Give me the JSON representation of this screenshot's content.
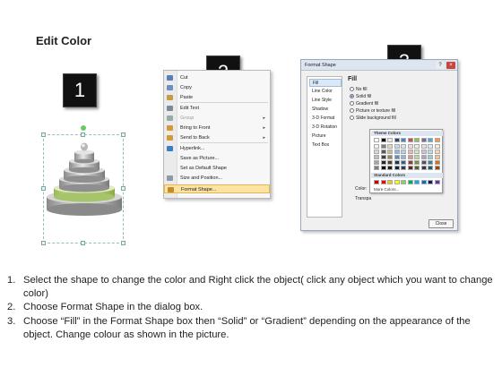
{
  "page": {
    "title": "Edit Color"
  },
  "badges": [
    "1",
    "2",
    "3"
  ],
  "context_menu": {
    "items": [
      {
        "label": "Cut",
        "icon": "scissors-icon",
        "icon_color": "#5a7fb5"
      },
      {
        "label": "Copy",
        "icon": "copy-icon",
        "icon_color": "#6e8fbf"
      },
      {
        "label": "Paste",
        "icon": "paste-icon",
        "icon_color": "#c59b45"
      },
      {
        "label": "Edit Text",
        "icon": "edit-text-icon",
        "icon_color": "#7a8a9a"
      },
      {
        "label": "Group",
        "icon": "group-icon",
        "icon_color": "#9aa",
        "disabled": true,
        "submenu": true
      },
      {
        "label": "Bring to Front",
        "icon": "bring-front-icon",
        "icon_color": "#d49a3a",
        "submenu": true
      },
      {
        "label": "Send to Back",
        "icon": "send-back-icon",
        "icon_color": "#d49a3a",
        "submenu": true
      },
      {
        "label": "Hyperlink...",
        "icon": "hyperlink-icon",
        "icon_color": "#3a7fc5"
      },
      {
        "label": "Save as Picture...",
        "icon": ""
      },
      {
        "label": "Set as Default Shape",
        "icon": ""
      },
      {
        "label": "Size and Position...",
        "icon": "size-position-icon",
        "icon_color": "#8a9aaa"
      },
      {
        "label": "Format Shape...",
        "icon": "format-shape-icon",
        "icon_color": "#c58a2a",
        "highlighted": true
      }
    ]
  },
  "dialog": {
    "title": "Format Shape",
    "nav": [
      "Fill",
      "Line Color",
      "Line Style",
      "Shadow",
      "3-D Format",
      "3-D Rotation",
      "Picture",
      "Text Box"
    ],
    "heading": "Fill",
    "options": [
      "No fill",
      "Solid fill",
      "Gradient fill",
      "Picture or texture fill",
      "Slide background fill"
    ],
    "selected_option": "Solid fill",
    "color_label": "Color:",
    "transparency_label": "Transpa",
    "palette": {
      "theme_label": "Theme Colors",
      "standard_label": "Standard Colors",
      "more_label": "More Colors...",
      "theme_top": [
        "#ffffff",
        "#000000",
        "#eeece1",
        "#1f497d",
        "#4f81bd",
        "#c0504d",
        "#9bbb59",
        "#8064a2",
        "#4bacc6",
        "#f79646"
      ],
      "theme_shades": [
        [
          "#f2f2f2",
          "#7f7f7f",
          "#ddd9c3",
          "#c6d9f0",
          "#dbe5f1",
          "#f2dcdb",
          "#ebf1dd",
          "#e5e0ec",
          "#dbeef3",
          "#fdeada"
        ],
        [
          "#d8d8d8",
          "#595959",
          "#c4bd97",
          "#8db3e2",
          "#b8cce4",
          "#e5b9b7",
          "#d7e3bc",
          "#ccc1d9",
          "#b7dde8",
          "#fbd5b5"
        ],
        [
          "#bfbfbf",
          "#3f3f3f",
          "#938953",
          "#548dd4",
          "#95b3d7",
          "#d99694",
          "#c3d69b",
          "#b2a2c7",
          "#92cddc",
          "#fac08f"
        ],
        [
          "#a5a5a5",
          "#262626",
          "#494429",
          "#17365d",
          "#366092",
          "#953734",
          "#76923c",
          "#5f497a",
          "#31859b",
          "#e36c09"
        ],
        [
          "#7f7f7f",
          "#0c0c0c",
          "#1d1b10",
          "#0f243e",
          "#244061",
          "#632423",
          "#4f6128",
          "#3f3151",
          "#205867",
          "#974806"
        ]
      ],
      "standard": [
        "#c00000",
        "#ff0000",
        "#ffc000",
        "#ffff00",
        "#92d050",
        "#00b050",
        "#00b0f0",
        "#0070c0",
        "#002060",
        "#7030a0"
      ]
    },
    "close_label": "Close"
  },
  "steps": [
    {
      "num": "1.",
      "text": "Select the shape to change the color and Right click the object( click any object which you want to change color)"
    },
    {
      "num": "2.",
      "text": "Choose Format Shape in the dialog box."
    },
    {
      "num": "3.",
      "text": "Choose “Fill” in the Format Shape box then “Solid” or “Gradient” depending on the appearance of the object. Change colour as shown in the picture."
    }
  ]
}
